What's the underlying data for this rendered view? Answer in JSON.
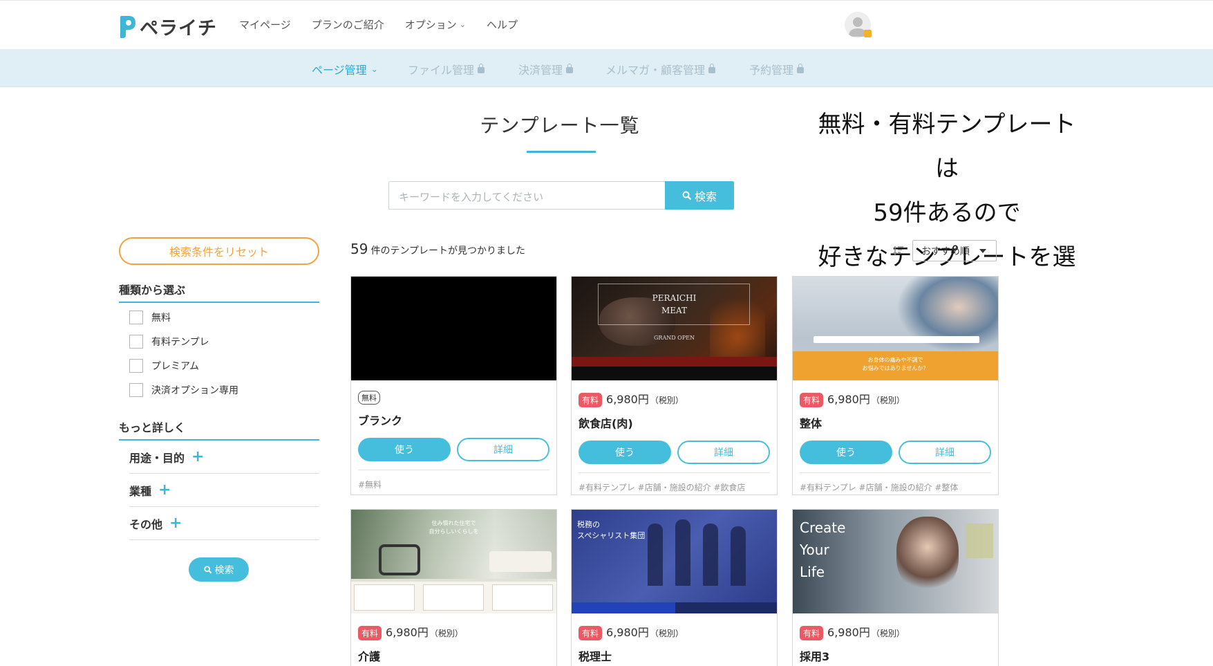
{
  "header": {
    "logo_text": "ペライチ",
    "nav": [
      "マイページ",
      "プランのご紹介",
      "オプション",
      "ヘルプ"
    ]
  },
  "subnav": {
    "items": [
      "ページ管理",
      "ファイル管理",
      "決済管理",
      "メルマガ・顧客管理",
      "予約管理"
    ]
  },
  "main": {
    "title": "テンプレート一覧",
    "caption": [
      "無料・有料テンプレートは",
      "59件あるので",
      "好きなテンプレートを選ぶ"
    ],
    "search": {
      "placeholder": "キーワードを入力してください",
      "button": "検索"
    }
  },
  "sidebar": {
    "reset": "検索条件をリセット",
    "type_heading": "種類から選ぶ",
    "types": [
      "無料",
      "有料テンプレ",
      "プレミアム",
      "決済オプション専用"
    ],
    "more_heading": "もっと詳しく",
    "accordions": [
      "用途・目的",
      "業種",
      "その他"
    ],
    "search_button": "検索"
  },
  "results": {
    "count": "59",
    "count_suffix": "件のテンプレートが見つかりました",
    "sort": "おすすめ順"
  },
  "cards": [
    {
      "badge": "無料",
      "price": "",
      "tax": "",
      "name": "ブランク",
      "use": "使う",
      "detail": "詳細",
      "tags": "#無料"
    },
    {
      "badge": "有料",
      "price": "6,980円",
      "tax": "（税別）",
      "name": "飲食店(肉)",
      "use": "使う",
      "detail": "詳細",
      "tags": "#有料テンプレ #店舗・施設の紹介 #飲食店",
      "thumb_text": [
        "PERAICHI",
        "MEAT",
        "GRAND OPEN"
      ]
    },
    {
      "badge": "有料",
      "price": "6,980円",
      "tax": "（税別）",
      "name": "整体",
      "use": "使う",
      "detail": "詳細",
      "tags": "#有料テンプレ #店舗・施設の紹介 #整体",
      "thumb_text": [
        "お身体の痛みや不調で",
        "お悩みではありませんか？"
      ]
    },
    {
      "badge": "有料",
      "price": "6,980円",
      "tax": "（税別）",
      "name": "介護",
      "thumb_text": [
        "住み慣れた住宅で",
        "自分らしいくらしを"
      ]
    },
    {
      "badge": "有料",
      "price": "6,980円",
      "tax": "（税別）",
      "name": "税理士",
      "thumb_text": [
        "税務の",
        "スペシャリスト集団"
      ]
    },
    {
      "badge": "有料",
      "price": "6,980円",
      "tax": "（税別）",
      "name": "採用3",
      "thumb_text": [
        "Create",
        "Your",
        "Life"
      ]
    }
  ]
}
